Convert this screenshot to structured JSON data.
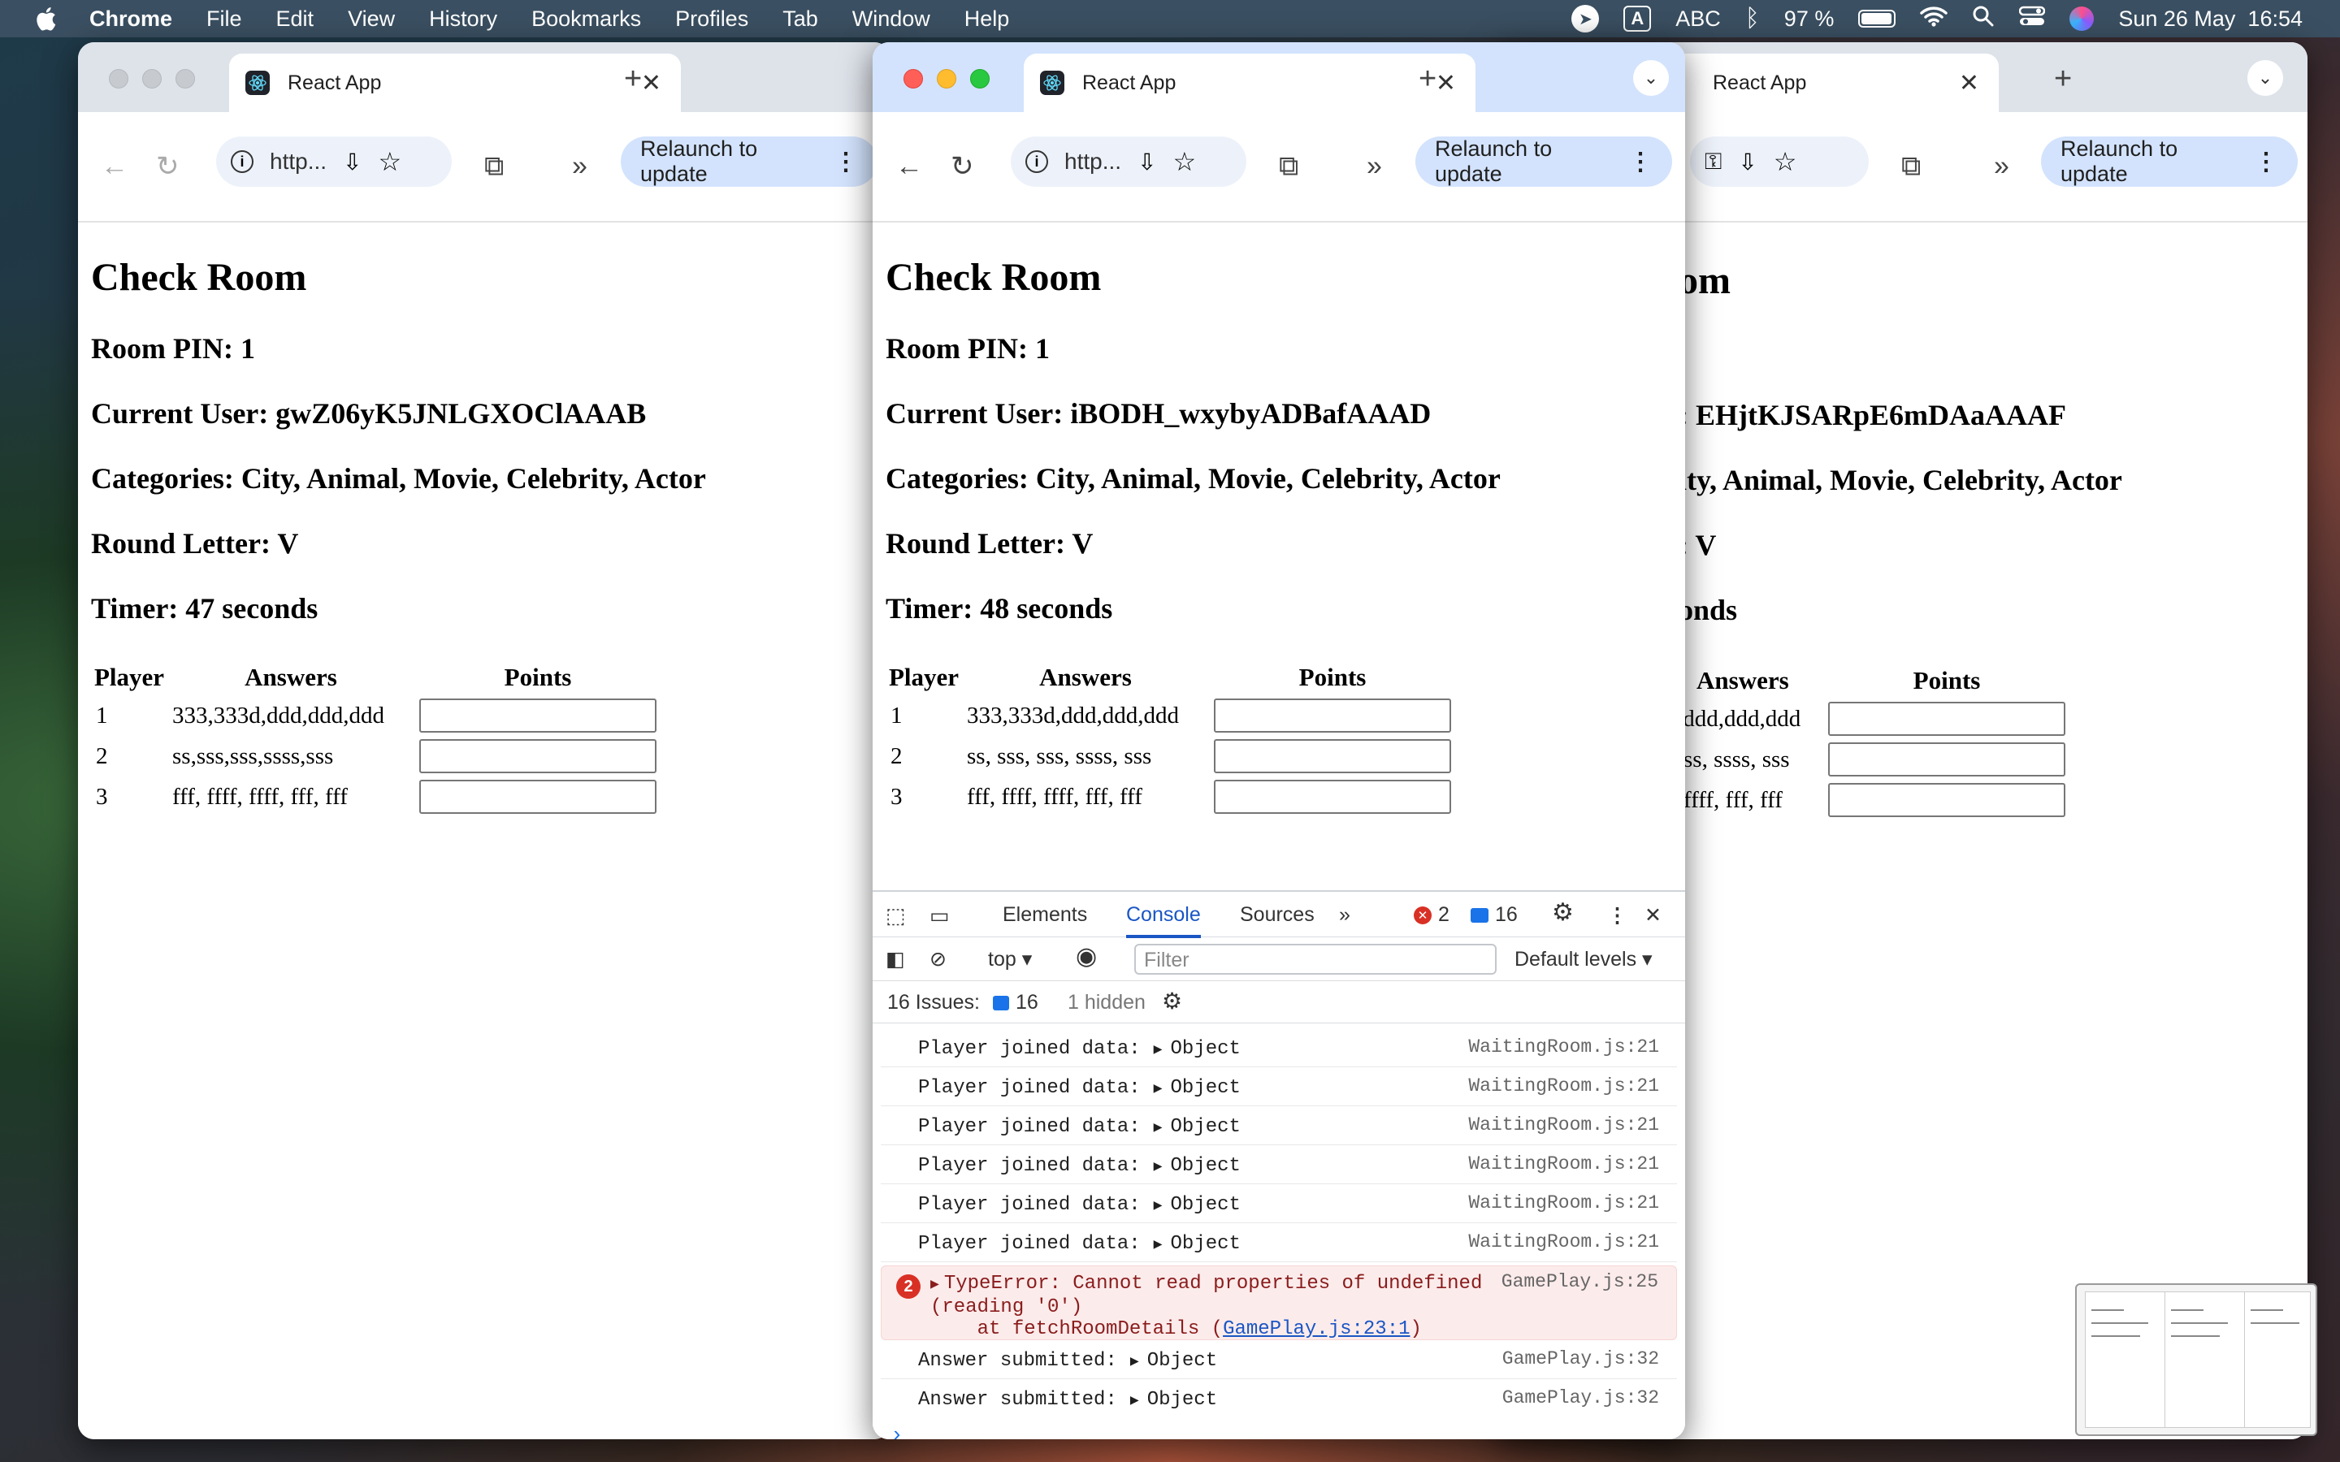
{
  "menubar": {
    "app_name": "Chrome",
    "items": [
      "File",
      "Edit",
      "View",
      "History",
      "Bookmarks",
      "Profiles",
      "Tab",
      "Window",
      "Help"
    ],
    "input_badge": "A",
    "input_source": "ABC",
    "battery_pct": "97 %",
    "battery_level": 0.97,
    "datetime": "Sun 26 May  16:54"
  },
  "browser": {
    "tab_title": "React App",
    "url_partial": "http...",
    "relaunch_label": "Relaunch to update"
  },
  "windows": [
    {
      "heading": "Check Room",
      "room_pin": "Room PIN: 1",
      "current_user": "Current User: gwZ06yK5JNLGXOClAAAB",
      "categories": "Categories: City, Animal, Movie, Celebrity, Actor",
      "round_letter": "Round Letter: V",
      "timer": "Timer: 47 seconds",
      "rows": [
        {
          "player": "1",
          "answers": "333,333d,ddd,ddd,ddd"
        },
        {
          "player": "2",
          "answers": "ss,sss,sss,ssss,sss"
        },
        {
          "player": "3",
          "answers": "fff, ffff, ffff, fff, fff"
        }
      ]
    },
    {
      "heading": "Check Room",
      "room_pin": "Room PIN: 1",
      "current_user": "Current User: iBODH_wxybyADBafAAAD",
      "categories": "Categories: City, Animal, Movie, Celebrity, Actor",
      "round_letter": "Round Letter: V",
      "timer": "Timer: 48 seconds",
      "rows": [
        {
          "player": "1",
          "answers": "333,333d,ddd,ddd,ddd"
        },
        {
          "player": "2",
          "answers": "ss, sss, sss, ssss, sss"
        },
        {
          "player": "3",
          "answers": "fff, ffff, ffff, fff, fff"
        }
      ]
    },
    {
      "heading": "om",
      "current_user": ": EHjtKJSARpE6mDAaAAAF",
      "categories": "ity, Animal, Movie, Celebrity, Actor",
      "round_letter": ": V",
      "timer": "onds",
      "rows": [
        {
          "answers": "l,ddd,ddd,ddd"
        },
        {
          "answers": "ss, ssss, sss"
        },
        {
          "answers": "ffff, fff, fff"
        }
      ]
    }
  ],
  "table_headers": {
    "player": "Player",
    "answers": "Answers",
    "points": "Points"
  },
  "devtools": {
    "tabs": [
      "Elements",
      "Console",
      "Sources"
    ],
    "error_count": "2",
    "message_count": "16",
    "context": "top",
    "filter_placeholder": "Filter",
    "levels": "Default levels",
    "issues_label": "16 Issues:",
    "issues_count": "16",
    "hidden_label": "1 hidden",
    "logs": [
      {
        "text": "Player joined data:",
        "obj": "Object",
        "src": "WaitingRoom.js:21"
      },
      {
        "text": "Player joined data:",
        "obj": "Object",
        "src": "WaitingRoom.js:21"
      },
      {
        "text": "Player joined data:",
        "obj": "Object",
        "src": "WaitingRoom.js:21"
      },
      {
        "text": "Player joined data:",
        "obj": "Object",
        "src": "WaitingRoom.js:21"
      },
      {
        "text": "Player joined data:",
        "obj": "Object",
        "src": "WaitingRoom.js:21"
      },
      {
        "text": "Player joined data:",
        "obj": "Object",
        "src": "WaitingRoom.js:21"
      }
    ],
    "error": {
      "count": "2",
      "line1": "TypeError: Cannot read properties of undefined",
      "line2": "(reading '0')",
      "line3_prefix": "    at fetchRoomDetails (",
      "line3_link": "GamePlay.js:23:1",
      "line3_suffix": ")",
      "src": "GamePlay.js:25"
    },
    "answers": [
      {
        "text": "Answer submitted:",
        "obj": "Object",
        "src": "GamePlay.js:32"
      },
      {
        "text": "Answer submitted:",
        "obj": "Object",
        "src": "GamePlay.js:32"
      }
    ],
    "prompt": "›"
  },
  "colors": {
    "menubar": "#3a4f61",
    "active_tab_strip": "#d3e3fd",
    "accent": "#1a56c4",
    "error": "#d93025"
  }
}
